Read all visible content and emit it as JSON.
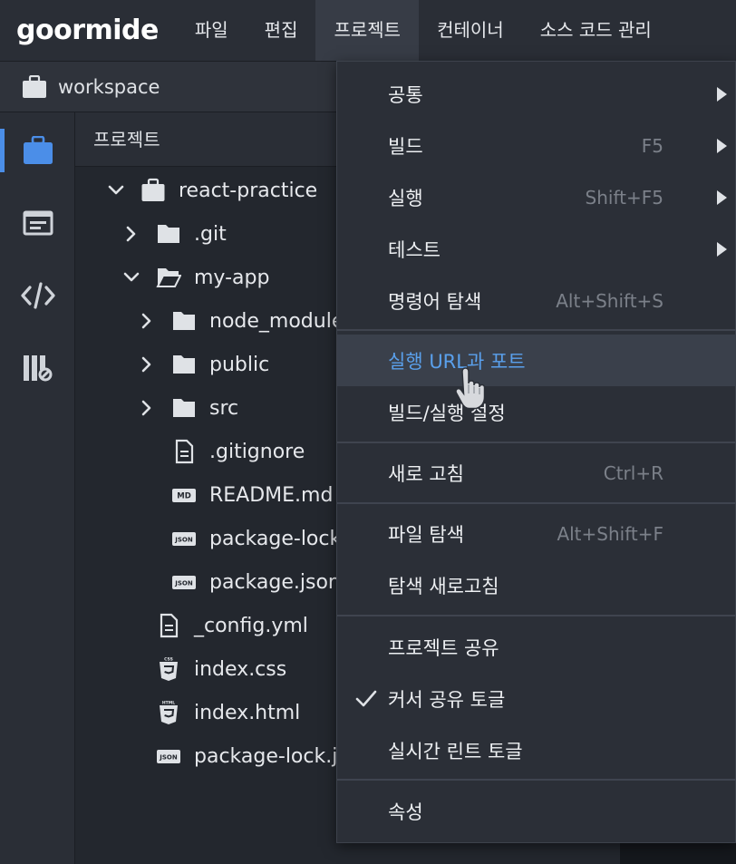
{
  "app": {
    "logo": "goormide"
  },
  "menubar": {
    "items": [
      {
        "label": "파일"
      },
      {
        "label": "편집"
      },
      {
        "label": "프로젝트",
        "active": true
      },
      {
        "label": "컨테이너"
      },
      {
        "label": "소스 코드 관리"
      }
    ]
  },
  "workspace": {
    "label": "workspace",
    "icon": "briefcase-icon"
  },
  "activity": {
    "items": [
      {
        "icon": "project-briefcase-icon",
        "active": true
      },
      {
        "icon": "panel-window-icon"
      },
      {
        "icon": "code-icon"
      },
      {
        "icon": "link-library-icon"
      }
    ]
  },
  "explorer": {
    "header": "프로젝트",
    "tree": [
      {
        "label": "react-practice",
        "icon": "briefcase-icon",
        "chevron": "down",
        "depth": 0
      },
      {
        "label": ".git",
        "icon": "folder-icon",
        "chevron": "right",
        "depth": 1
      },
      {
        "label": "my-app",
        "icon": "folder-open-icon",
        "chevron": "down",
        "depth": 1
      },
      {
        "label": "node_modules",
        "icon": "folder-icon",
        "chevron": "right",
        "depth": 2
      },
      {
        "label": "public",
        "icon": "folder-icon",
        "chevron": "right",
        "depth": 2
      },
      {
        "label": "src",
        "icon": "folder-icon",
        "chevron": "right",
        "depth": 2
      },
      {
        "label": ".gitignore",
        "icon": "file-text-icon",
        "chevron": "none",
        "depth": 2
      },
      {
        "label": "README.md",
        "icon": "md-file-icon",
        "badge": "MD",
        "chevron": "none",
        "depth": 2
      },
      {
        "label": "package-lock.json",
        "icon": "json-file-icon",
        "badge": "JSON",
        "chevron": "none",
        "depth": 2
      },
      {
        "label": "package.json",
        "icon": "json-file-icon",
        "badge": "JSON",
        "chevron": "none",
        "depth": 2
      },
      {
        "label": "_config.yml",
        "icon": "file-text-icon",
        "chevron": "none",
        "depth": 1
      },
      {
        "label": "index.css",
        "icon": "css3-icon",
        "badge": "CSS",
        "chevron": "none",
        "depth": 1
      },
      {
        "label": "index.html",
        "icon": "html5-icon",
        "badge": "HTML",
        "chevron": "none",
        "depth": 1
      },
      {
        "label": "package-lock.json",
        "icon": "json-file-icon",
        "badge": "JSON",
        "chevron": "none",
        "depth": 1
      }
    ]
  },
  "dropdown": {
    "items": [
      {
        "label": "공통",
        "shortcut": "",
        "submenu": true
      },
      {
        "label": "빌드",
        "shortcut": "F5",
        "submenu": true
      },
      {
        "label": "실행",
        "shortcut": "Shift+F5",
        "submenu": true
      },
      {
        "label": "테스트",
        "shortcut": "",
        "submenu": true
      },
      {
        "label": "명령어 탐색",
        "shortcut": "Alt+Shift+S",
        "submenu": false
      },
      {
        "label": "실행 URL과 포트",
        "shortcut": "",
        "submenu": false,
        "highlighted": true
      },
      {
        "label": "빌드/실행 설정",
        "shortcut": "",
        "submenu": false
      },
      {
        "label": "새로 고침",
        "shortcut": "Ctrl+R",
        "submenu": false
      },
      {
        "label": "파일 탐색",
        "shortcut": "Alt+Shift+F",
        "submenu": false
      },
      {
        "label": "탐색 새로고침",
        "shortcut": "",
        "submenu": false
      },
      {
        "label": "프로젝트 공유",
        "shortcut": "",
        "submenu": false
      },
      {
        "label": "커서 공유 토글",
        "shortcut": "",
        "submenu": false,
        "checked": true
      },
      {
        "label": "실시간 린트 토글",
        "shortcut": "",
        "submenu": false
      },
      {
        "label": "속성",
        "shortcut": "",
        "submenu": false
      }
    ]
  },
  "colors": {
    "accent": "#4b8ee8",
    "highlight_text": "#5aa0ec",
    "menubar_bg": "#2a2e36",
    "dropdown_bg": "#2b2f37"
  }
}
